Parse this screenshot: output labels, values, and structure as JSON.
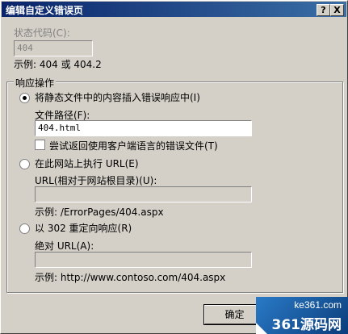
{
  "window": {
    "title": "编辑自定义错误页",
    "help_label": "?",
    "close_label": "X"
  },
  "status": {
    "label": "状态代码(C):",
    "value": "404",
    "example": "示例: 404 或 404.2"
  },
  "group": {
    "legend": "响应操作"
  },
  "option_static": {
    "label": "将静态文件中的内容插入错误响应中(I)",
    "path_label": "文件路径(F):",
    "path_value": "404.html",
    "checkbox_label": "尝试返回使用客户端语言的错误文件(T)"
  },
  "option_execute": {
    "label": "在此网站上执行 URL(E)",
    "url_label": "URL(相对于网站根目录)(U):",
    "url_value": "",
    "example": "示例: /ErrorPages/404.aspx"
  },
  "option_redirect": {
    "label": "以 302 重定向响应(R)",
    "url_label": "绝对 URL(A):",
    "url_value": "",
    "example": "示例: http://www.contoso.com/404.aspx"
  },
  "buttons": {
    "ok": "确定"
  },
  "watermark": {
    "line1": "ke361.com",
    "line2": "361源码网"
  }
}
